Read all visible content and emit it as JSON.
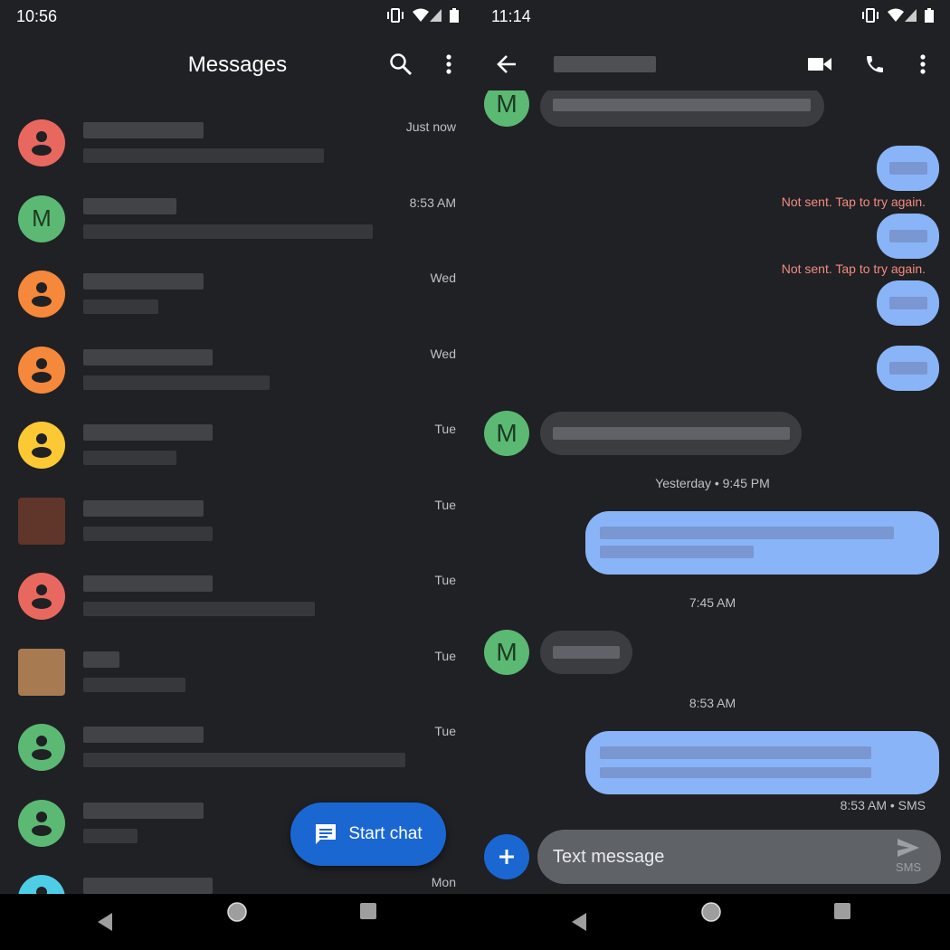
{
  "left": {
    "status_time": "10:56",
    "title": "Messages",
    "icons": {
      "search": "search-icon",
      "more": "more-vert-icon"
    },
    "conversations": [
      {
        "avatar": "person",
        "color": "#e8685f",
        "time": "Just now"
      },
      {
        "avatar": "M",
        "color": "#5bb974",
        "time": "8:53 AM"
      },
      {
        "avatar": "person",
        "color": "#f5883a",
        "time": "Wed"
      },
      {
        "avatar": "person",
        "color": "#f5883a",
        "time": "Wed"
      },
      {
        "avatar": "person",
        "color": "#fcc934",
        "time": "Tue"
      },
      {
        "avatar": "photo",
        "color": "#6b3a2a",
        "time": "Tue"
      },
      {
        "avatar": "person",
        "color": "#e8685f",
        "time": "Tue"
      },
      {
        "avatar": "photo",
        "color": "#c08a5a",
        "time": "Tue"
      },
      {
        "avatar": "person",
        "color": "#5bb974",
        "time": "Tue"
      },
      {
        "avatar": "person",
        "color": "#5bb974",
        "time": ""
      },
      {
        "avatar": "person",
        "color": "#4ecde6",
        "time": "Mon"
      }
    ],
    "fab_label": "Start chat"
  },
  "right": {
    "status_time": "11:14",
    "icons": {
      "back": "arrow-back-icon",
      "video": "videocam-icon",
      "call": "phone-icon",
      "more": "more-vert-icon"
    },
    "contact_initial": "M",
    "error_text": "Not sent. Tap to try again.",
    "stamp_yesterday": "Yesterday • 9:45 PM",
    "stamp_745": "7:45 AM",
    "stamp_853": "8:53 AM",
    "last_status": "8:53 AM • SMS",
    "compose_placeholder": "Text message",
    "send_label": "SMS"
  },
  "colors": {
    "background": "#202124",
    "sent_bubble": "#8ab4f8",
    "received_bubble": "#3c3d40",
    "fab": "#1a67d2",
    "error": "#f28b82"
  }
}
